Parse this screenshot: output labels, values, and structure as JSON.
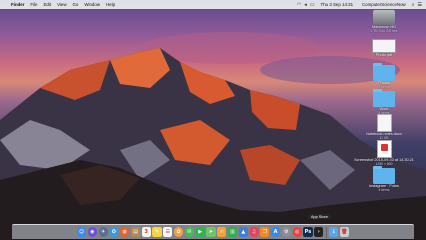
{
  "menubar": {
    "app_name": "Finder",
    "menus": [
      "File",
      "Edit",
      "View",
      "Go",
      "Window",
      "Help"
    ],
    "datetime": "Thu 3 Sep 14:31",
    "user": "ComputerScienceNow"
  },
  "desktop_icons": [
    {
      "label": "Macintosh HD",
      "sub": "1 TB, 940 GB free",
      "kind": "drive"
    },
    {
      "label": "Photo.pdf",
      "sub": "",
      "kind": "blank"
    },
    {
      "label": "Photos",
      "sub": "8 items",
      "kind": "folder"
    },
    {
      "label": "Work",
      "sub": "4 items",
      "kind": "folder"
    },
    {
      "label": "Notebook notes.docx",
      "sub": "11 KB",
      "kind": "doc"
    },
    {
      "label": "Screenshot 2015-09-03 at 14.30.21",
      "sub": "1280 × 800",
      "kind": "pdfdoc"
    },
    {
      "label": "Instagram · Fotos",
      "sub": "4 items",
      "kind": "folder"
    }
  ],
  "dock": {
    "tooltip": "App Store",
    "apps": [
      {
        "name": "finder-icon",
        "glyph": "☺",
        "color": "#3d8be8"
      },
      {
        "name": "siri-icon",
        "glyph": "◉",
        "color": "#6b4fd8",
        "round": true
      },
      {
        "name": "launchpad-icon",
        "glyph": "✈",
        "color": "#5a6f8e",
        "round": true
      },
      {
        "name": "safari-icon",
        "glyph": "✪",
        "color": "#2f9be6",
        "round": true
      },
      {
        "name": "firefox-icon",
        "glyph": "◍",
        "color": "#e5642a",
        "round": true
      },
      {
        "name": "contacts-icon",
        "glyph": "▤",
        "color": "#b08a55"
      },
      {
        "name": "calendar-icon",
        "glyph": "3",
        "color": "#f2f2f2"
      },
      {
        "name": "notes-icon",
        "glyph": "✎",
        "color": "#f5d547"
      },
      {
        "name": "reminders-icon",
        "glyph": "☰",
        "color": "#f7f7f7"
      },
      {
        "name": "photos-icon",
        "glyph": "✿",
        "color": "#f0a24a",
        "round": true
      },
      {
        "name": "messages-icon",
        "glyph": "✉",
        "color": "#3fbf52",
        "round": true
      },
      {
        "name": "facetime-icon",
        "glyph": "▶",
        "color": "#2fb34a"
      },
      {
        "name": "maps-icon",
        "glyph": "➤",
        "color": "#6fc26e"
      },
      {
        "name": "pages-icon",
        "glyph": "✍",
        "color": "#f3a331"
      },
      {
        "name": "numbers-icon",
        "glyph": "▥",
        "color": "#2fae4e"
      },
      {
        "name": "keynote-icon",
        "glyph": "▲",
        "color": "#3d7ed9"
      },
      {
        "name": "music-icon",
        "glyph": "♫",
        "color": "#e8415c",
        "round": true
      },
      {
        "name": "ibooks-icon",
        "glyph": "❐",
        "color": "#f08a24"
      },
      {
        "name": "appstore-icon",
        "glyph": "A",
        "color": "#2c8cf0",
        "round": true
      },
      {
        "name": "preferences-icon",
        "glyph": "⚙",
        "color": "#8a8f98",
        "round": true
      },
      {
        "name": "chrome-icon",
        "glyph": "◎",
        "color": "#e94335",
        "round": true
      },
      {
        "name": "photoshop-icon",
        "glyph": "Ps",
        "color": "#0f2c4d"
      },
      {
        "name": "terminal-icon",
        "glyph": "›",
        "color": "#222"
      }
    ],
    "trailing": [
      {
        "name": "downloads-stack-icon",
        "glyph": "↓",
        "color": "#5aa6e6"
      },
      {
        "name": "trash-icon",
        "glyph": "🗑",
        "color": "#c9ccd2"
      }
    ]
  }
}
